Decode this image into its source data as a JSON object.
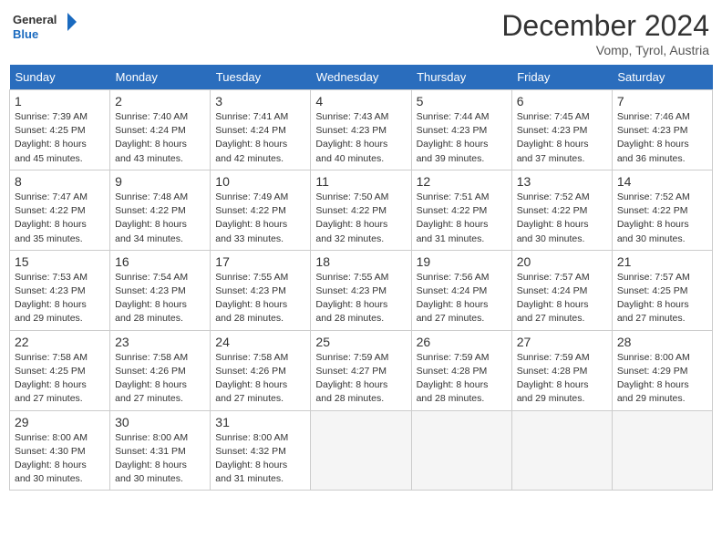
{
  "header": {
    "logo_general": "General",
    "logo_blue": "Blue",
    "month_title": "December 2024",
    "location": "Vomp, Tyrol, Austria"
  },
  "days_of_week": [
    "Sunday",
    "Monday",
    "Tuesday",
    "Wednesday",
    "Thursday",
    "Friday",
    "Saturday"
  ],
  "weeks": [
    [
      {
        "day": 1,
        "sunrise": "7:39 AM",
        "sunset": "4:25 PM",
        "daylight": "8 hours and 45 minutes."
      },
      {
        "day": 2,
        "sunrise": "7:40 AM",
        "sunset": "4:24 PM",
        "daylight": "8 hours and 43 minutes."
      },
      {
        "day": 3,
        "sunrise": "7:41 AM",
        "sunset": "4:24 PM",
        "daylight": "8 hours and 42 minutes."
      },
      {
        "day": 4,
        "sunrise": "7:43 AM",
        "sunset": "4:23 PM",
        "daylight": "8 hours and 40 minutes."
      },
      {
        "day": 5,
        "sunrise": "7:44 AM",
        "sunset": "4:23 PM",
        "daylight": "8 hours and 39 minutes."
      },
      {
        "day": 6,
        "sunrise": "7:45 AM",
        "sunset": "4:23 PM",
        "daylight": "8 hours and 37 minutes."
      },
      {
        "day": 7,
        "sunrise": "7:46 AM",
        "sunset": "4:23 PM",
        "daylight": "8 hours and 36 minutes."
      }
    ],
    [
      {
        "day": 8,
        "sunrise": "7:47 AM",
        "sunset": "4:22 PM",
        "daylight": "8 hours and 35 minutes."
      },
      {
        "day": 9,
        "sunrise": "7:48 AM",
        "sunset": "4:22 PM",
        "daylight": "8 hours and 34 minutes."
      },
      {
        "day": 10,
        "sunrise": "7:49 AM",
        "sunset": "4:22 PM",
        "daylight": "8 hours and 33 minutes."
      },
      {
        "day": 11,
        "sunrise": "7:50 AM",
        "sunset": "4:22 PM",
        "daylight": "8 hours and 32 minutes."
      },
      {
        "day": 12,
        "sunrise": "7:51 AM",
        "sunset": "4:22 PM",
        "daylight": "8 hours and 31 minutes."
      },
      {
        "day": 13,
        "sunrise": "7:52 AM",
        "sunset": "4:22 PM",
        "daylight": "8 hours and 30 minutes."
      },
      {
        "day": 14,
        "sunrise": "7:52 AM",
        "sunset": "4:22 PM",
        "daylight": "8 hours and 30 minutes."
      }
    ],
    [
      {
        "day": 15,
        "sunrise": "7:53 AM",
        "sunset": "4:23 PM",
        "daylight": "8 hours and 29 minutes."
      },
      {
        "day": 16,
        "sunrise": "7:54 AM",
        "sunset": "4:23 PM",
        "daylight": "8 hours and 28 minutes."
      },
      {
        "day": 17,
        "sunrise": "7:55 AM",
        "sunset": "4:23 PM",
        "daylight": "8 hours and 28 minutes."
      },
      {
        "day": 18,
        "sunrise": "7:55 AM",
        "sunset": "4:23 PM",
        "daylight": "8 hours and 28 minutes."
      },
      {
        "day": 19,
        "sunrise": "7:56 AM",
        "sunset": "4:24 PM",
        "daylight": "8 hours and 27 minutes."
      },
      {
        "day": 20,
        "sunrise": "7:57 AM",
        "sunset": "4:24 PM",
        "daylight": "8 hours and 27 minutes."
      },
      {
        "day": 21,
        "sunrise": "7:57 AM",
        "sunset": "4:25 PM",
        "daylight": "8 hours and 27 minutes."
      }
    ],
    [
      {
        "day": 22,
        "sunrise": "7:58 AM",
        "sunset": "4:25 PM",
        "daylight": "8 hours and 27 minutes."
      },
      {
        "day": 23,
        "sunrise": "7:58 AM",
        "sunset": "4:26 PM",
        "daylight": "8 hours and 27 minutes."
      },
      {
        "day": 24,
        "sunrise": "7:58 AM",
        "sunset": "4:26 PM",
        "daylight": "8 hours and 27 minutes."
      },
      {
        "day": 25,
        "sunrise": "7:59 AM",
        "sunset": "4:27 PM",
        "daylight": "8 hours and 28 minutes."
      },
      {
        "day": 26,
        "sunrise": "7:59 AM",
        "sunset": "4:28 PM",
        "daylight": "8 hours and 28 minutes."
      },
      {
        "day": 27,
        "sunrise": "7:59 AM",
        "sunset": "4:28 PM",
        "daylight": "8 hours and 29 minutes."
      },
      {
        "day": 28,
        "sunrise": "8:00 AM",
        "sunset": "4:29 PM",
        "daylight": "8 hours and 29 minutes."
      }
    ],
    [
      {
        "day": 29,
        "sunrise": "8:00 AM",
        "sunset": "4:30 PM",
        "daylight": "8 hours and 30 minutes."
      },
      {
        "day": 30,
        "sunrise": "8:00 AM",
        "sunset": "4:31 PM",
        "daylight": "8 hours and 30 minutes."
      },
      {
        "day": 31,
        "sunrise": "8:00 AM",
        "sunset": "4:32 PM",
        "daylight": "8 hours and 31 minutes."
      },
      null,
      null,
      null,
      null
    ]
  ]
}
